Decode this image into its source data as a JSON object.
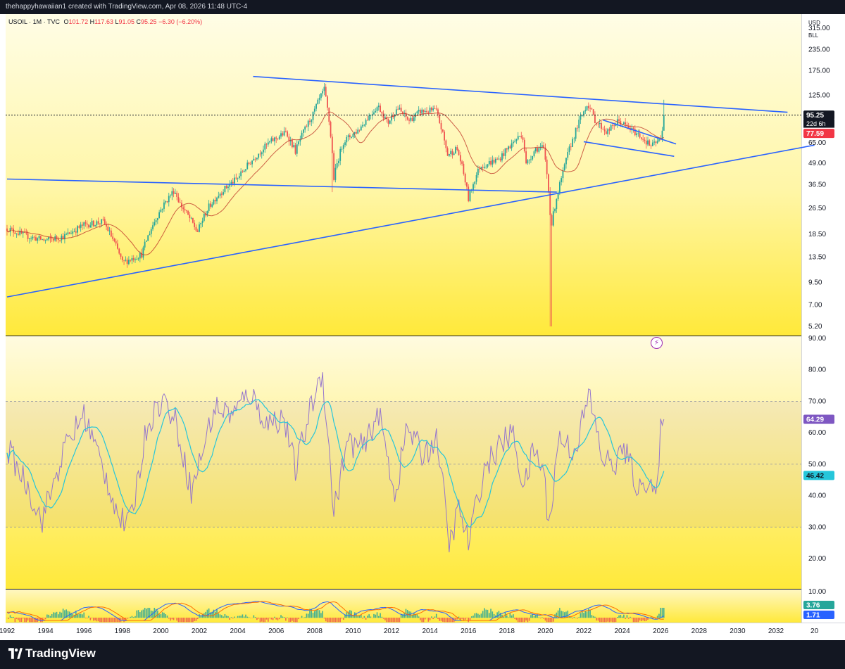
{
  "header": {
    "attribution": "thehappyhawaiian1 created with TradingView.com, Apr 08, 2026 11:48 UTC-4"
  },
  "legend": {
    "symbol": "USOIL · 1M · TVC",
    "open_label": "O",
    "open": "101.72",
    "high_label": "H",
    "high": "117.63",
    "low_label": "L",
    "low": "91.05",
    "close_label": "C",
    "close": "95.25",
    "change": "−6.30 (−6.20%)"
  },
  "scale_unit": {
    "currency": "USD",
    "unit": "BLL"
  },
  "footer": {
    "brand": "TradingView"
  },
  "colors": {
    "up": "#26a69a",
    "down": "#ef5350",
    "ma": "#c0392b",
    "trend": "#2962ff",
    "rsi": "#9575cd",
    "rsi_ma": "#26c6da",
    "macd": "#2962ff",
    "signal": "#ff6d00",
    "price_label": "#131722",
    "ma_label": "#f23645",
    "rsi_label": "#7e57c2",
    "rsi_ma_label": "#26c6da"
  },
  "chart_data": [
    {
      "type": "candlestick",
      "series_name": "USOIL",
      "interval": "1M",
      "y_scale": "log",
      "ylim": [
        5.2,
        315
      ],
      "y_ticks": [
        "315.00",
        "235.00",
        "175.00",
        "125.00",
        "65.00",
        "49.00",
        "36.50",
        "26.50",
        "18.50",
        "13.50",
        "9.50",
        "7.00",
        "5.20"
      ],
      "x_ticks": [
        "1992",
        "1994",
        "1996",
        "1998",
        "2000",
        "2002",
        "2004",
        "2006",
        "2008",
        "2010",
        "2012",
        "2014",
        "2016",
        "2018",
        "2020",
        "2022",
        "2024",
        "2026",
        "2028",
        "2030",
        "2032",
        "20"
      ],
      "xlim": [
        1992,
        2034
      ],
      "anchors_close": [
        [
          1992,
          20
        ],
        [
          1993,
          18
        ],
        [
          1994,
          17
        ],
        [
          1995,
          18
        ],
        [
          1996,
          21
        ],
        [
          1997,
          22
        ],
        [
          1998,
          12.5
        ],
        [
          1999,
          14
        ],
        [
          1999.5,
          20
        ],
        [
          2000,
          26
        ],
        [
          2000.7,
          34
        ],
        [
          2001,
          28
        ],
        [
          2001.9,
          19
        ],
        [
          2002.5,
          27
        ],
        [
          2003,
          32
        ],
        [
          2004,
          40
        ],
        [
          2004.8,
          52
        ],
        [
          2005.7,
          66
        ],
        [
          2006.5,
          75
        ],
        [
          2007,
          58
        ],
        [
          2007.9,
          95
        ],
        [
          2008.5,
          135
        ],
        [
          2009.0,
          40
        ],
        [
          2009.5,
          66
        ],
        [
          2010.3,
          78
        ],
        [
          2011.3,
          108
        ],
        [
          2011.8,
          85
        ],
        [
          2012.3,
          105
        ],
        [
          2012.9,
          88
        ],
        [
          2013.5,
          100
        ],
        [
          2014.3,
          102
        ],
        [
          2014.9,
          55
        ],
        [
          2015.4,
          60
        ],
        [
          2016.0,
          30
        ],
        [
          2016.6,
          47
        ],
        [
          2017.6,
          52
        ],
        [
          2018.8,
          74
        ],
        [
          2019.0,
          48
        ],
        [
          2019.5,
          60
        ],
        [
          2019.9,
          61
        ],
        [
          2020.3,
          20
        ],
        [
          2020.9,
          42
        ],
        [
          2021.5,
          72
        ],
        [
          2022.2,
          112
        ],
        [
          2022.6,
          88
        ],
        [
          2023.2,
          75
        ],
        [
          2023.8,
          88
        ],
        [
          2024.3,
          80
        ],
        [
          2024.9,
          72
        ],
        [
          2025.5,
          62
        ],
        [
          2026.0,
          68
        ],
        [
          2026.2,
          95.25
        ]
      ],
      "moving_average": {
        "last_value": "77.59"
      },
      "last_price": "95.25",
      "countdown": "22d 6h",
      "trendlines": [
        {
          "x": [
            2004.8,
            2032.6
          ],
          "y": [
            162,
            99
          ]
        },
        {
          "x": [
            1992.0,
            2020.6
          ],
          "y": [
            39.5,
            33
          ]
        },
        {
          "x": [
            1992.0,
            2034.0
          ],
          "y": [
            7.8,
            63
          ]
        },
        {
          "x": [
            2023.0,
            2026.8
          ],
          "y": [
            89,
            64
          ]
        },
        {
          "x": [
            2022.0,
            2026.7
          ],
          "y": [
            66,
            54
          ]
        }
      ]
    },
    {
      "type": "line",
      "name": "RSI",
      "ylim": [
        10,
        90
      ],
      "y_ticks": [
        "90.00",
        "80.00",
        "70.00",
        "60.00",
        "50.00",
        "40.00",
        "30.00",
        "20.00"
      ],
      "bands": {
        "upper": 70,
        "middle": 50,
        "lower": 30
      },
      "anchors": [
        [
          1992,
          55
        ],
        [
          1993,
          44
        ],
        [
          1993.8,
          32
        ],
        [
          1995,
          55
        ],
        [
          1996,
          66
        ],
        [
          1997.2,
          45
        ],
        [
          1997.9,
          32
        ],
        [
          1998.4,
          31
        ],
        [
          1999.3,
          63
        ],
        [
          2000.1,
          71
        ],
        [
          2000.8,
          63
        ],
        [
          2001.6,
          41
        ],
        [
          2002.2,
          55
        ],
        [
          2002.8,
          68
        ],
        [
          2003.8,
          66
        ],
        [
          2004.6,
          73
        ],
        [
          2005.5,
          63
        ],
        [
          2006.4,
          65
        ],
        [
          2007.0,
          48
        ],
        [
          2007.8,
          68
        ],
        [
          2008.4,
          80
        ],
        [
          2009.0,
          35
        ],
        [
          2009.7,
          57
        ],
        [
          2010.6,
          55
        ],
        [
          2011.3,
          67
        ],
        [
          2012.2,
          40
        ],
        [
          2012.8,
          62
        ],
        [
          2013.6,
          53
        ],
        [
          2014.4,
          58
        ],
        [
          2015.0,
          24
        ],
        [
          2015.5,
          36
        ],
        [
          2016.0,
          25
        ],
        [
          2016.8,
          48
        ],
        [
          2017.5,
          55
        ],
        [
          2018.3,
          60
        ],
        [
          2018.9,
          42
        ],
        [
          2019.4,
          55
        ],
        [
          2019.9,
          48
        ],
        [
          2020.2,
          30
        ],
        [
          2020.7,
          59
        ],
        [
          2021.5,
          54
        ],
        [
          2022.3,
          72
        ],
        [
          2022.9,
          53
        ],
        [
          2023.5,
          49
        ],
        [
          2024.1,
          55
        ],
        [
          2024.9,
          41
        ],
        [
          2025.4,
          47
        ],
        [
          2025.8,
          38
        ],
        [
          2026.0,
          60
        ],
        [
          2026.2,
          64.29
        ]
      ],
      "last_value": "64.29",
      "ma_last_value": "46.42"
    },
    {
      "type": "histogram",
      "name": "MACD",
      "y_ticks": [
        "10.00"
      ],
      "last_value": "3.76",
      "signal_last_value": "1.71"
    }
  ]
}
